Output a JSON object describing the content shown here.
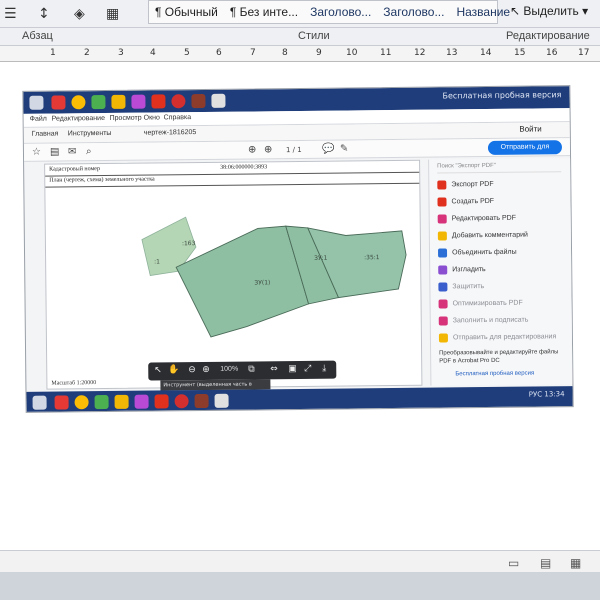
{
  "word": {
    "styles": [
      "¶ Обычный",
      "¶ Без инте...",
      "Заголово...",
      "Заголово...",
      "Название"
    ],
    "select_label": "Выделить",
    "paragraph_group": "Абзац",
    "styles_group": "Стили",
    "editing_group": "Редактирование",
    "ruler_ticks": [
      "1",
      "2",
      "3",
      "4",
      "5",
      "6",
      "7",
      "8",
      "9",
      "10",
      "11",
      "12",
      "13",
      "14",
      "15",
      "16",
      "17"
    ]
  },
  "screenshot": {
    "trial_top": "Бесплатная пробная версия",
    "menu": [
      "Файл",
      "Редактирование",
      "Просмотр",
      "Окно",
      "Справка"
    ],
    "tabs": [
      "Главная",
      "Инструменты",
      "чертеж-1816205"
    ],
    "login_label": "Войти",
    "share_label": "Отправить для отзывов",
    "page_nav": "1 / 1",
    "doc": {
      "cadastral_label": "Кадастровый номер",
      "cadastral_value": "38:06:000000:3893",
      "plan_title": "План (чертеж, схема) земельного участка",
      "scale": "Масштаб 1:20000",
      "parcel_labels": [
        ":163",
        ":1",
        "ЗУ(1)",
        "ЗУ:1",
        ":35:1"
      ]
    },
    "float_toolbar": {
      "zoom": "100%"
    },
    "tooltip": "Инструмент (выделенная часть в изображении)",
    "panel": {
      "search_placeholder": "Поиск \"Экспорт PDF\"",
      "items": [
        {
          "label": "Экспорт PDF",
          "color": "#e0301e",
          "dim": false
        },
        {
          "label": "Создать PDF",
          "color": "#e0301e",
          "dim": false
        },
        {
          "label": "Редактировать PDF",
          "color": "#d6337a",
          "dim": false
        },
        {
          "label": "Добавить комментарий",
          "color": "#f2b705",
          "dim": false
        },
        {
          "label": "Объединить файлы",
          "color": "#2b6fd6",
          "dim": false
        },
        {
          "label": "Изгладить",
          "color": "#8a4fd1",
          "dim": false
        },
        {
          "label": "Защитить",
          "color": "#3a5fcd",
          "dim": true
        },
        {
          "label": "Оптимизировать PDF",
          "color": "#d6337a",
          "dim": true
        },
        {
          "label": "Заполнить и подписать",
          "color": "#d6337a",
          "dim": true
        },
        {
          "label": "Отправить для редактирования",
          "color": "#f2b705",
          "dim": true
        }
      ],
      "promo": "Преобразовывайте и редактируйте файлы PDF в Acrobat Pro DC",
      "trial": "Бесплатная пробная версия"
    },
    "tray_time": "13:34",
    "tray_lang": "РУС"
  },
  "colors": {
    "parcel_fill": "#8fbfa3",
    "parcel_stroke": "#4a6b58",
    "taskbar": "#1f3d7a",
    "accent": "#1473e6"
  }
}
